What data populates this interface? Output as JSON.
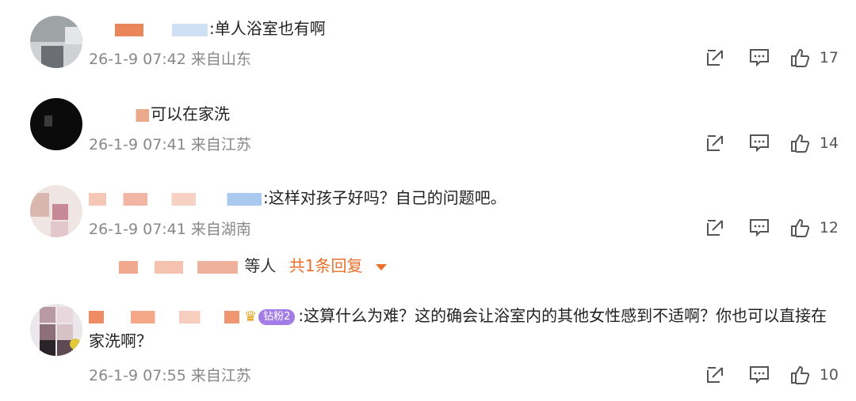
{
  "comments": [
    {
      "text": "单人浴室也有啊",
      "time": "26-1-9 07:42",
      "location": "来自山东",
      "likes": "17"
    },
    {
      "text": "可以在家洗",
      "time": "26-1-9 07:41",
      "location": "来自江苏",
      "likes": "14"
    },
    {
      "text": "这样对孩子好吗？自己的问题吧。",
      "time": "26-1-9 07:41",
      "location": "来自湖南",
      "likes": "12"
    },
    {
      "text": "这算什么为难？这的确会让浴室内的其他女性感到不适啊？你也可以直接在家洗啊？",
      "time": "26-1-9 07:55",
      "location": "来自江苏",
      "likes": "10",
      "badge": "钻粉2"
    }
  ],
  "reply_summary": {
    "who": "等人",
    "more": "共1条回复"
  },
  "colon": ":",
  "icons": {
    "share": "share-icon",
    "comment": "comment-icon",
    "like": "thumbs-up-icon"
  },
  "colors": {
    "accent": "#e8702a",
    "meta": "#888888",
    "badge": "#a47ce6"
  }
}
